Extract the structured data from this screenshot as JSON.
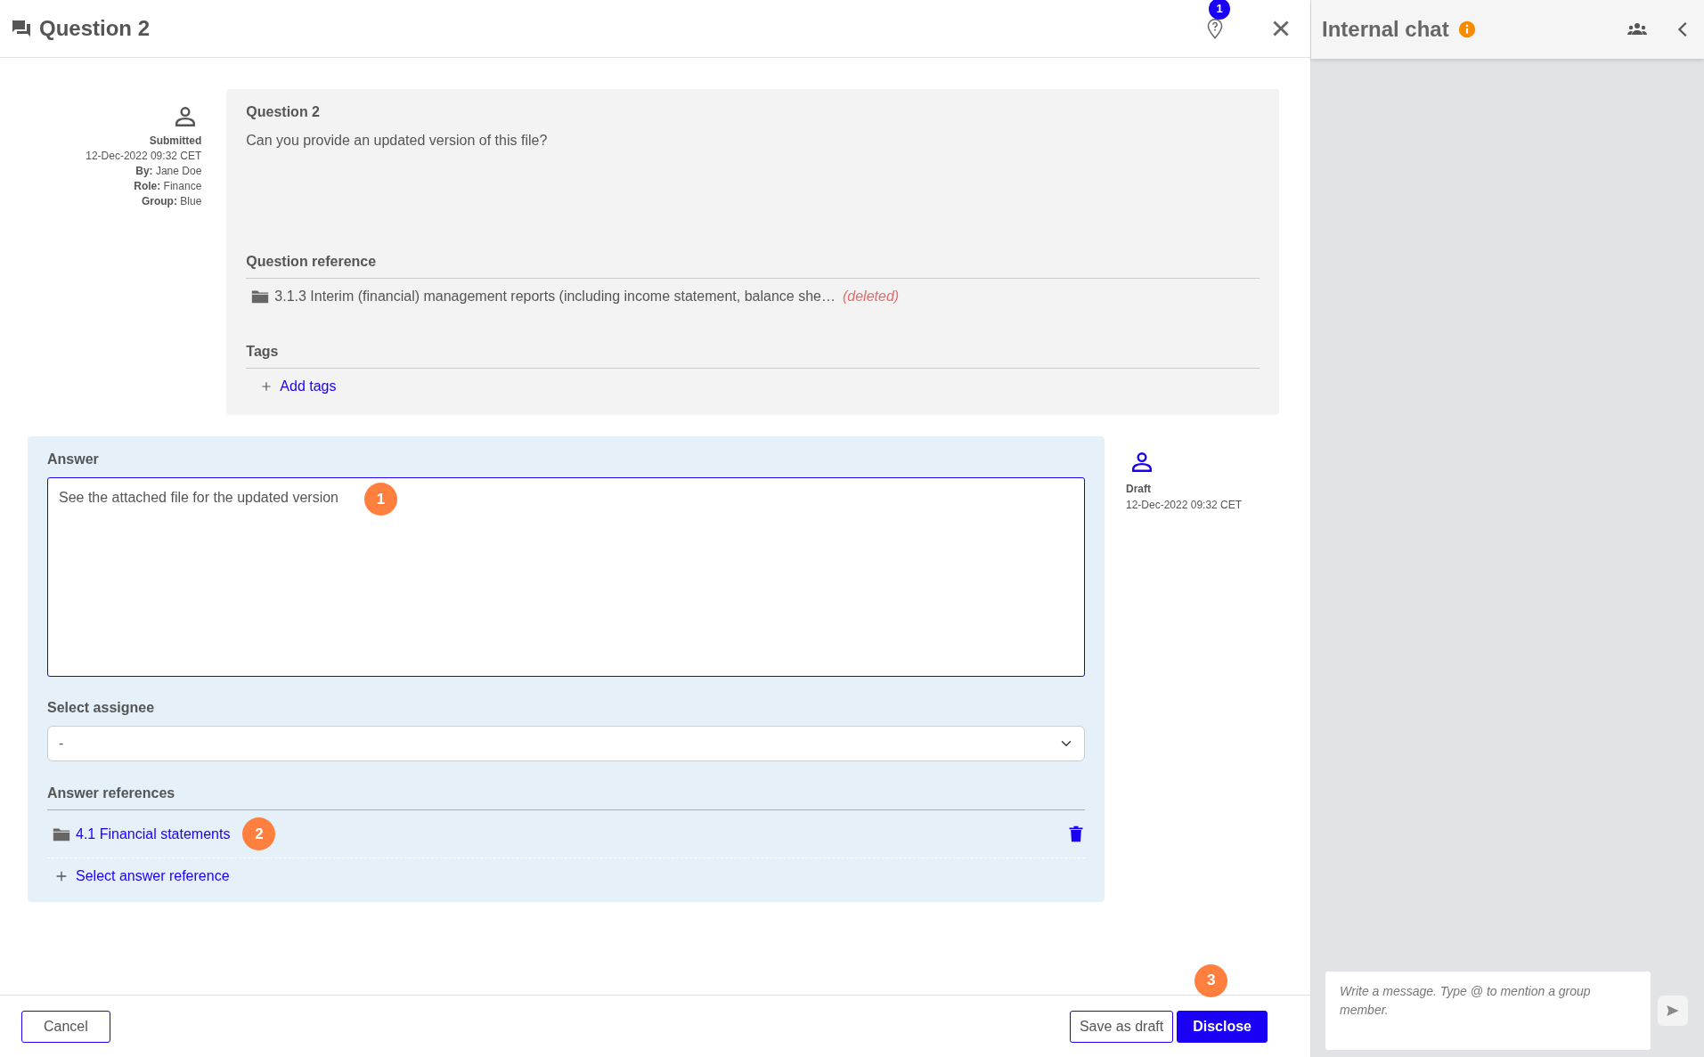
{
  "header": {
    "title": "Question 2",
    "badge": "1"
  },
  "question": {
    "meta": {
      "status": "Submitted",
      "date": "12-Dec-2022 09:32 CET",
      "lines": [
        {
          "label": "By:",
          "value": "Jane Doe"
        },
        {
          "label": "Role:",
          "value": "Finance"
        },
        {
          "label": "Group:",
          "value": "Blue"
        }
      ]
    },
    "title": "Question 2",
    "text": "Can you provide an updated version of this file?",
    "reference_heading": "Question reference",
    "reference": {
      "text": "3.1.3 Interim (financial) management reports (including income statement, balance she…",
      "note": "(deleted)"
    },
    "tags_heading": "Tags",
    "add_tags": "Add tags"
  },
  "answer": {
    "heading": "Answer",
    "value": "See the attached file for the updated version",
    "callout": "1",
    "assignee_label": "Select assignee",
    "assignee_value": "-",
    "references_heading": "Answer references",
    "references": [
      {
        "text": "4.1 Financial statements",
        "callout": "2"
      }
    ],
    "select_reference": "Select answer reference",
    "meta": {
      "status": "Draft",
      "date": "12-Dec-2022 09:32 CET"
    }
  },
  "footer": {
    "cancel": "Cancel",
    "save_draft": "Save as draft",
    "disclose": "Disclose",
    "disclose_callout": "3"
  },
  "chat": {
    "title": "Internal chat",
    "placeholder": "Write a message. Type @ to mention a group member."
  }
}
